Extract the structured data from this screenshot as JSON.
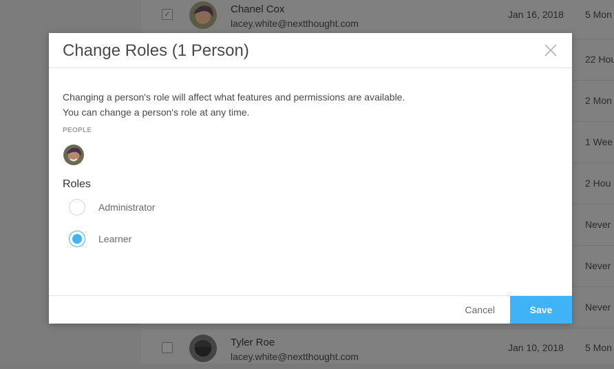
{
  "modal": {
    "title": "Change Roles (1 Person)",
    "description_line1": "Changing a person's role will affect what features and permissions are available.",
    "description_line2": "You can change a person's role at any time.",
    "people_label": "PEOPLE",
    "roles_heading": "Roles",
    "roles": [
      {
        "label": "Administrator",
        "selected": false
      },
      {
        "label": "Learner",
        "selected": true
      }
    ],
    "cancel_label": "Cancel",
    "save_label": "Save"
  },
  "background_table": {
    "rows": [
      {
        "checked": true,
        "name": "Chanel Cox",
        "email": "lacey.white@nextthought.com",
        "date": "Jan 16, 2018",
        "last_active": "5 Mon"
      },
      {
        "last_active": "22 Hou"
      },
      {
        "last_active": "2 Mon"
      },
      {
        "last_active": "1 Wee"
      },
      {
        "last_active": "2 Hou"
      },
      {
        "last_active": "Never"
      },
      {
        "last_active": "Never"
      },
      {
        "last_active": "Never"
      },
      {
        "checked": false,
        "name": "Tyler Roe",
        "email": "lacey.white@nextthought.com",
        "date": "Jan 10, 2018",
        "last_active": "5 Mon"
      }
    ]
  },
  "colors": {
    "accent": "#3fb3f6",
    "overlay": "#7a7a7a"
  }
}
